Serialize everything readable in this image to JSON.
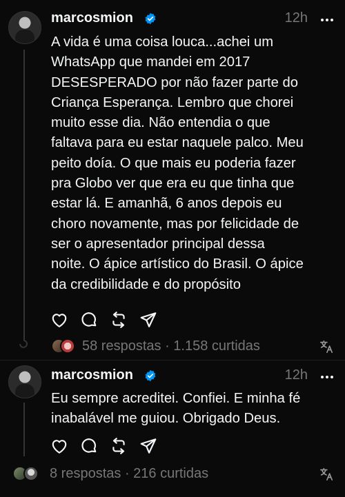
{
  "posts": [
    {
      "username": "marcosmion",
      "time": "12h",
      "text": "A vida é uma coisa louca...achei um\nWhatsApp que mandei em 2017\nDESESPERADO por não fazer parte do\nCriança Esperança. Lembro que chorei\nmuito esse dia. Não entendia o que\nfaltava para eu estar naquele palco. Meu\npeito doía. O que mais eu poderia fazer\npra Globo ver que era eu que tinha que\nestar lá. E amanhã, 6 anos depois eu\nchoro novamente, mas por felicidade de\nser o apresentador principal dessa\nnoite. O ápice artístico do Brasil. O ápice\nda credibilidade e do propósito",
      "stats": "58 respostas · 1.158 curtidas"
    },
    {
      "username": "marcosmion",
      "time": "12h",
      "text": "Eu sempre acreditei. Confiei. E minha fé\ninabalável me guiou. Obrigado Deus.",
      "stats": "8 respostas · 216 curtidas"
    }
  ],
  "icons": {
    "like": "heart-icon",
    "reply": "comment-icon",
    "repost": "repost-icon",
    "share": "send-icon",
    "more": "more-icon",
    "verified": "verified-badge-icon",
    "translate": "translate-icon"
  },
  "colors": {
    "background": "#0a0a0a",
    "text": "#f3f5f7",
    "secondary": "#777777",
    "verified": "#0095f6"
  }
}
